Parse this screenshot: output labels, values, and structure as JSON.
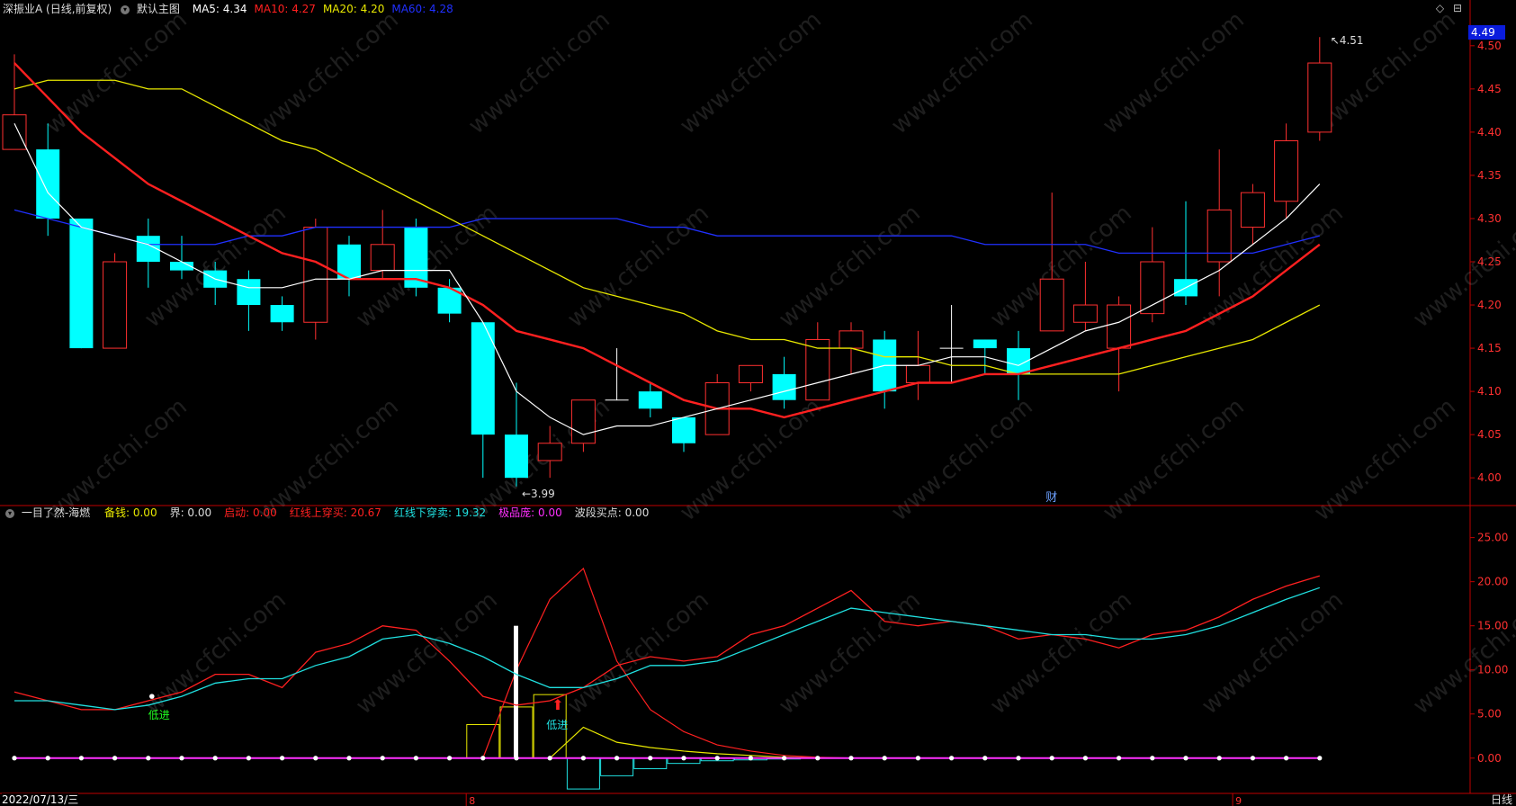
{
  "header": {
    "stock_name": "深振业A",
    "period_note": "(日线,前复权)",
    "main_chart_label": "默认主图",
    "ma": [
      {
        "label": "MA5: 4.34",
        "color": "#ffffff"
      },
      {
        "label": "MA10: 4.27",
        "color": "#ff2020"
      },
      {
        "label": "MA20: 4.20",
        "color": "#e8e800"
      },
      {
        "label": "MA60: 4.28",
        "color": "#2030ff"
      }
    ]
  },
  "indicator": {
    "name": "一目了然-海燃",
    "items": [
      {
        "label": "备钱: 0.00",
        "color": "#e8e800"
      },
      {
        "label": "界: 0.00",
        "color": "#dddddd"
      },
      {
        "label": "启动: 0.00",
        "color": "#ff2020"
      },
      {
        "label": "红线上穿买: 20.67",
        "color": "#ff2020"
      },
      {
        "label": "红线下穿卖: 19.32",
        "color": "#20e0e0"
      },
      {
        "label": "极品庞: 0.00",
        "color": "#ff30ff"
      },
      {
        "label": "波段买点: 0.00",
        "color": "#dddddd"
      }
    ]
  },
  "footer": {
    "date": "2022/07/13/三",
    "period": "日线",
    "month_marks": [
      "8",
      "9"
    ]
  },
  "last_price": "4.49",
  "annotations": {
    "high_label": "4.51",
    "low_label": "3.99",
    "finance_flag": "财",
    "low_entry_1": "低进",
    "low_entry_2": "低进"
  },
  "watermark": "www.cfchi.com",
  "colors": {
    "up": "#ff3030",
    "down": "#00ffff",
    "ma5": "#ffffff",
    "ma10": "#ff2020",
    "ma20": "#e8e800",
    "ma60": "#2030ff",
    "axis": "#c00000",
    "tick_text": "#ff3030",
    "red_line": "#ff2020",
    "cyan_line": "#20e0e0",
    "magenta": "#ff30ff"
  },
  "chart_data": [
    {
      "type": "candlestick",
      "title": "深振业A (日线,前复权)",
      "ylim": [
        3.97,
        4.53
      ],
      "yticks": [
        "4.00",
        "4.05",
        "4.10",
        "4.15",
        "4.20",
        "4.25",
        "4.30",
        "4.35",
        "4.40",
        "4.45",
        "4.50"
      ],
      "candles": [
        {
          "o": 4.38,
          "c": 4.42,
          "h": 4.49,
          "l": 4.38
        },
        {
          "o": 4.38,
          "c": 4.3,
          "h": 4.41,
          "l": 4.28
        },
        {
          "o": 4.3,
          "c": 4.15,
          "h": 4.3,
          "l": 4.15
        },
        {
          "o": 4.15,
          "c": 4.25,
          "h": 4.26,
          "l": 4.15
        },
        {
          "o": 4.28,
          "c": 4.25,
          "h": 4.3,
          "l": 4.22
        },
        {
          "o": 4.25,
          "c": 4.24,
          "h": 4.28,
          "l": 4.23
        },
        {
          "o": 4.24,
          "c": 4.22,
          "h": 4.25,
          "l": 4.2
        },
        {
          "o": 4.23,
          "c": 4.2,
          "h": 4.24,
          "l": 4.17
        },
        {
          "o": 4.2,
          "c": 4.18,
          "h": 4.21,
          "l": 4.17
        },
        {
          "o": 4.18,
          "c": 4.29,
          "h": 4.3,
          "l": 4.16
        },
        {
          "o": 4.27,
          "c": 4.23,
          "h": 4.28,
          "l": 4.21
        },
        {
          "o": 4.24,
          "c": 4.27,
          "h": 4.31,
          "l": 4.23
        },
        {
          "o": 4.29,
          "c": 4.22,
          "h": 4.3,
          "l": 4.21
        },
        {
          "o": 4.22,
          "c": 4.19,
          "h": 4.23,
          "l": 4.18
        },
        {
          "o": 4.18,
          "c": 4.05,
          "h": 4.18,
          "l": 4.0
        },
        {
          "o": 4.05,
          "c": 4.0,
          "h": 4.11,
          "l": 3.99
        },
        {
          "o": 4.02,
          "c": 4.04,
          "h": 4.06,
          "l": 4.0
        },
        {
          "o": 4.04,
          "c": 4.09,
          "h": 4.09,
          "l": 4.03
        },
        {
          "o": 4.09,
          "c": 4.09,
          "h": 4.15,
          "l": 4.09
        },
        {
          "o": 4.1,
          "c": 4.08,
          "h": 4.11,
          "l": 4.07
        },
        {
          "o": 4.07,
          "c": 4.04,
          "h": 4.07,
          "l": 4.03
        },
        {
          "o": 4.05,
          "c": 4.11,
          "h": 4.12,
          "l": 4.05
        },
        {
          "o": 4.11,
          "c": 4.13,
          "h": 4.13,
          "l": 4.1
        },
        {
          "o": 4.12,
          "c": 4.09,
          "h": 4.14,
          "l": 4.08
        },
        {
          "o": 4.09,
          "c": 4.16,
          "h": 4.18,
          "l": 4.09
        },
        {
          "o": 4.15,
          "c": 4.17,
          "h": 4.18,
          "l": 4.12
        },
        {
          "o": 4.16,
          "c": 4.1,
          "h": 4.17,
          "l": 4.08
        },
        {
          "o": 4.11,
          "c": 4.13,
          "h": 4.17,
          "l": 4.09
        },
        {
          "o": 4.15,
          "c": 4.15,
          "h": 4.2,
          "l": 4.11
        },
        {
          "o": 4.16,
          "c": 4.15,
          "h": 4.16,
          "l": 4.12
        },
        {
          "o": 4.15,
          "c": 4.12,
          "h": 4.17,
          "l": 4.09
        },
        {
          "o": 4.17,
          "c": 4.23,
          "h": 4.33,
          "l": 4.17
        },
        {
          "o": 4.18,
          "c": 4.2,
          "h": 4.25,
          "l": 4.17
        },
        {
          "o": 4.15,
          "c": 4.2,
          "h": 4.21,
          "l": 4.1
        },
        {
          "o": 4.19,
          "c": 4.25,
          "h": 4.29,
          "l": 4.18
        },
        {
          "o": 4.23,
          "c": 4.21,
          "h": 4.32,
          "l": 4.2
        },
        {
          "o": 4.25,
          "c": 4.31,
          "h": 4.38,
          "l": 4.21
        },
        {
          "o": 4.29,
          "c": 4.33,
          "h": 4.34,
          "l": 4.27
        },
        {
          "o": 4.32,
          "c": 4.39,
          "h": 4.41,
          "l": 4.3
        },
        {
          "o": 4.4,
          "c": 4.48,
          "h": 4.51,
          "l": 4.39
        }
      ],
      "ma5": [
        4.41,
        4.33,
        4.29,
        4.28,
        4.27,
        4.25,
        4.23,
        4.22,
        4.22,
        4.23,
        4.23,
        4.24,
        4.24,
        4.24,
        4.18,
        4.1,
        4.07,
        4.05,
        4.06,
        4.06,
        4.07,
        4.08,
        4.09,
        4.1,
        4.11,
        4.12,
        4.13,
        4.13,
        4.14,
        4.14,
        4.13,
        4.15,
        4.17,
        4.18,
        4.2,
        4.22,
        4.24,
        4.27,
        4.3,
        4.34
      ],
      "ma10": [
        4.48,
        4.44,
        4.4,
        4.37,
        4.34,
        4.32,
        4.3,
        4.28,
        4.26,
        4.25,
        4.23,
        4.23,
        4.23,
        4.22,
        4.2,
        4.17,
        4.16,
        4.15,
        4.13,
        4.11,
        4.09,
        4.08,
        4.08,
        4.07,
        4.08,
        4.09,
        4.1,
        4.11,
        4.11,
        4.12,
        4.12,
        4.13,
        4.14,
        4.15,
        4.16,
        4.17,
        4.19,
        4.21,
        4.24,
        4.27
      ],
      "ma20": [
        4.45,
        4.46,
        4.46,
        4.46,
        4.45,
        4.45,
        4.43,
        4.41,
        4.39,
        4.38,
        4.36,
        4.34,
        4.32,
        4.3,
        4.28,
        4.26,
        4.24,
        4.22,
        4.21,
        4.2,
        4.19,
        4.17,
        4.16,
        4.16,
        4.15,
        4.15,
        4.14,
        4.14,
        4.13,
        4.13,
        4.12,
        4.12,
        4.12,
        4.12,
        4.13,
        4.14,
        4.15,
        4.16,
        4.18,
        4.2
      ],
      "ma60": [
        4.31,
        4.3,
        4.29,
        4.28,
        4.27,
        4.27,
        4.27,
        4.28,
        4.28,
        4.29,
        4.29,
        4.29,
        4.29,
        4.29,
        4.3,
        4.3,
        4.3,
        4.3,
        4.3,
        4.29,
        4.29,
        4.28,
        4.28,
        4.28,
        4.28,
        4.28,
        4.28,
        4.28,
        4.28,
        4.27,
        4.27,
        4.27,
        4.27,
        4.26,
        4.26,
        4.26,
        4.26,
        4.26,
        4.27,
        4.28
      ]
    },
    {
      "type": "line",
      "title": "一目了然-海燃",
      "ylim": [
        -4,
        27
      ],
      "yticks": [
        "0.00",
        "5.00",
        "10.00",
        "15.00",
        "20.00",
        "25.00"
      ],
      "series": [
        {
          "name": "红线上穿买",
          "values": [
            7.5,
            6.5,
            5.5,
            5.5,
            6.5,
            7.5,
            9.5,
            9.5,
            8.0,
            12.0,
            13.0,
            15.0,
            14.5,
            11.0,
            7.0,
            6.0,
            6.5,
            8.0,
            10.5,
            11.5,
            11.0,
            11.5,
            14.0,
            15.0,
            17.0,
            19.0,
            15.5,
            15.0,
            15.5,
            15.0,
            13.5,
            14.0,
            13.5,
            12.5,
            14.0,
            14.5,
            16.0,
            18.0,
            19.5,
            20.67
          ]
        },
        {
          "name": "红线下穿卖",
          "values": [
            6.5,
            6.5,
            6.0,
            5.5,
            6.0,
            7.0,
            8.5,
            9.0,
            9.0,
            10.5,
            11.5,
            13.5,
            14.0,
            13.0,
            11.5,
            9.5,
            8.0,
            8.0,
            9.0,
            10.5,
            10.5,
            11.0,
            12.5,
            14.0,
            15.5,
            17.0,
            16.5,
            16.0,
            15.5,
            15.0,
            14.5,
            14.0,
            14.0,
            13.5,
            13.5,
            14.0,
            15.0,
            16.5,
            18.0,
            19.32
          ]
        }
      ],
      "bars": {
        "yellow": [
          0,
          0,
          0,
          0,
          0,
          0,
          0,
          0,
          0,
          0,
          0,
          0,
          0,
          0,
          3.8,
          5.8,
          7.2,
          0,
          0,
          0,
          0,
          0,
          0,
          0,
          0,
          0,
          0,
          0,
          0,
          0,
          0,
          0,
          0,
          0,
          0,
          0,
          0,
          0,
          0,
          0
        ],
        "cyan_neg": [
          0,
          0,
          0,
          0,
          0,
          0,
          0,
          0,
          0,
          0,
          0,
          0,
          0,
          0,
          0,
          0,
          0,
          -3.5,
          -2.0,
          -1.2,
          -0.6,
          -0.3,
          -0.2,
          -0.1,
          0,
          0,
          0,
          0,
          0,
          0,
          0,
          0,
          0,
          0,
          0,
          0,
          0,
          0,
          0,
          0
        ],
        "white_spike_index": 15,
        "white_spike_value": 15.0,
        "red_peak": [
          0,
          0,
          0,
          0,
          0,
          0,
          0,
          0,
          0,
          0,
          0,
          0,
          0,
          0,
          0,
          10.0,
          18.0,
          21.5,
          11.0,
          5.5,
          3.0,
          1.5,
          0.8,
          0.3,
          0.1,
          0,
          0,
          0,
          0,
          0,
          0,
          0,
          0,
          0,
          0,
          0,
          0,
          0,
          0,
          0
        ],
        "yellow_decay": [
          0,
          0,
          0,
          0,
          0,
          0,
          0,
          0,
          0,
          0,
          0,
          0,
          0,
          0,
          0,
          0,
          0,
          3.5,
          1.8,
          1.2,
          0.8,
          0.5,
          0.3,
          0.1,
          0,
          0,
          0,
          0,
          0,
          0,
          0,
          0,
          0,
          0,
          0,
          0,
          0,
          0,
          0,
          0
        ]
      },
      "low_entry_dots": [
        4,
        16
      ],
      "zero_dots": true
    }
  ]
}
